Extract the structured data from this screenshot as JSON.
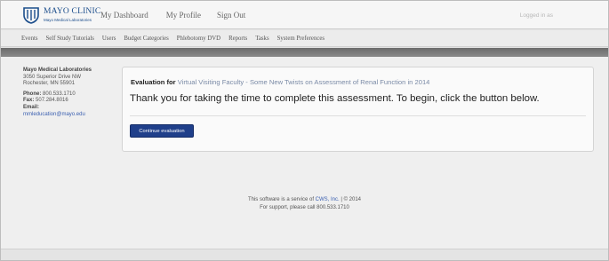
{
  "header": {
    "logo_name": "MAYO CLINIC",
    "logo_sub": "Mayo Medical Laboratories",
    "nav": [
      "My Dashboard",
      "My Profile",
      "Sign Out"
    ],
    "logged_in": "Logged in as"
  },
  "subnav": [
    "Events",
    "Self Study Tutorials",
    "Users",
    "Budget Categories",
    "Phlebotomy DVD",
    "Reports",
    "Tasks",
    "System Preferences"
  ],
  "sidebar": {
    "org": "Mayo Medical Laboratories",
    "street": "3050 Superior Drive NW",
    "city": "Rochester, MN 55901",
    "phone_label": "Phone:",
    "phone": "800.533.1710",
    "fax_label": "Fax:",
    "fax": "507.284.8016",
    "email_label": "Email:",
    "email": "mmleducation@mayo.edu"
  },
  "main": {
    "eval_label": "Evaluation for",
    "eval_title": "Virtual Visiting Faculty - Some New Twists on Assessment of Renal Function in 2014",
    "thanks": "Thank you for taking the time to complete this assessment. To begin, click the button below.",
    "button": "Continue evaluation"
  },
  "footer": {
    "line1_pre": "This software is a service of",
    "line1_link": "CWS, Inc.",
    "line1_post": "| © 2014",
    "line2": "For support, please call 800.533.1710"
  }
}
